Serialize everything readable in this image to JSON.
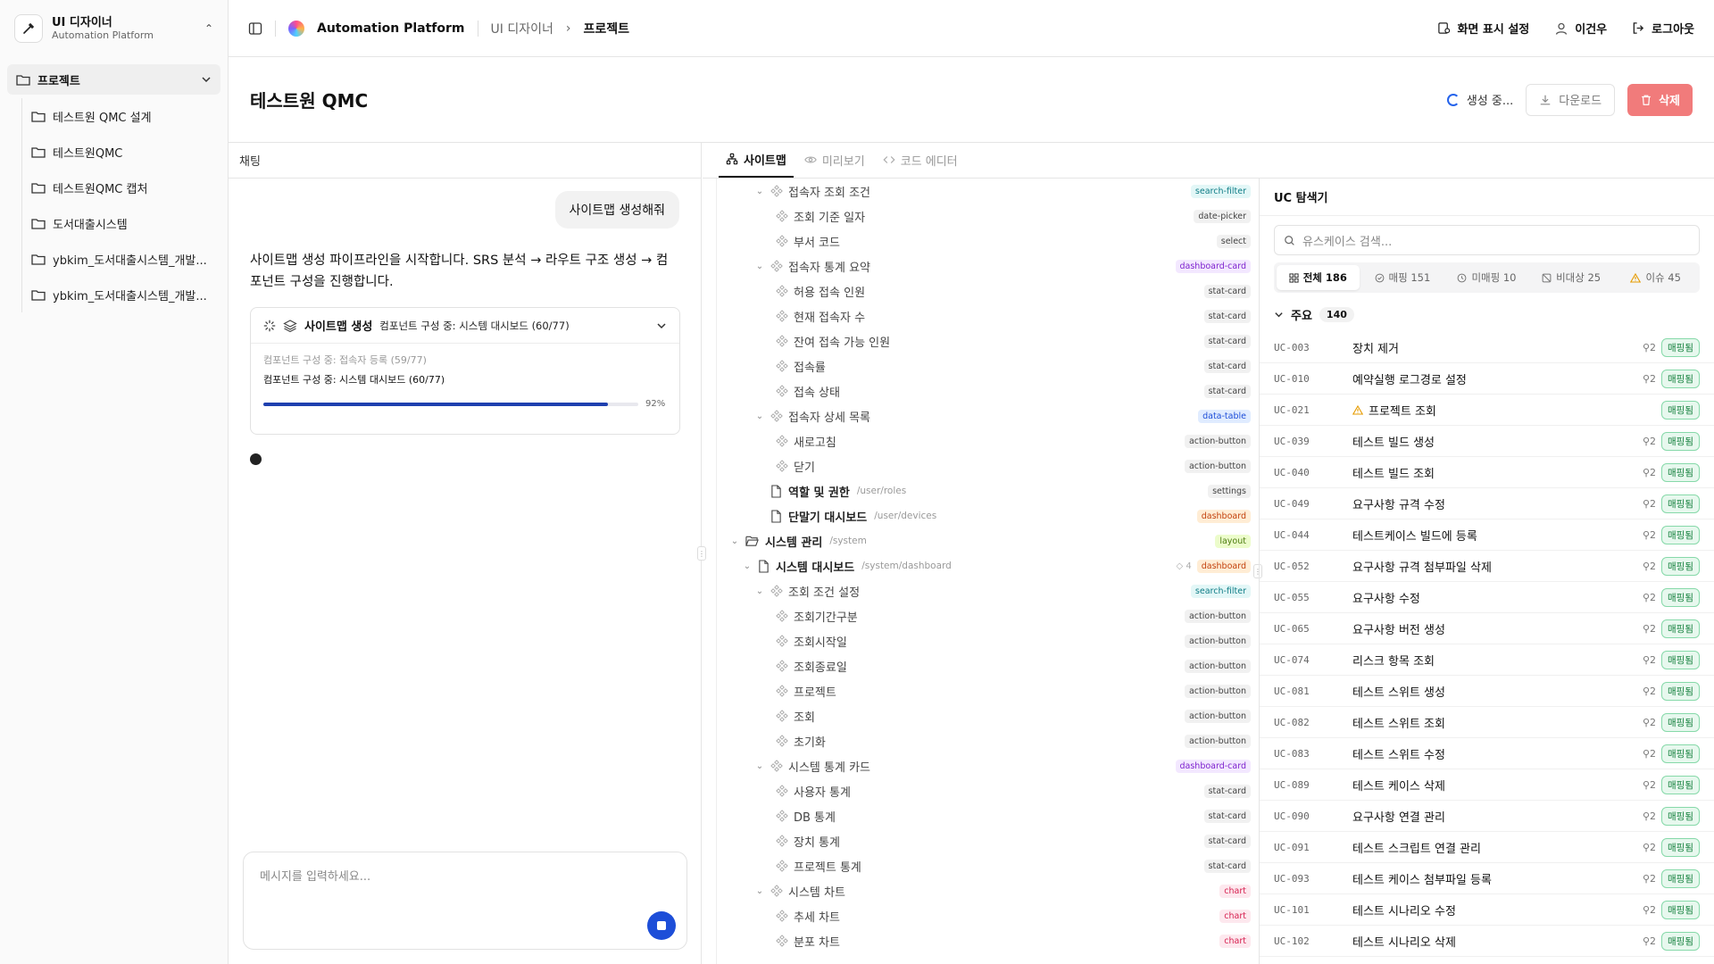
{
  "sidebar": {
    "brand_title": "UI 디자이너",
    "brand_subtitle": "Automation Platform",
    "group_label": "프로젝트",
    "items": [
      {
        "label": "테스트원 QMC 설계"
      },
      {
        "label": "테스트원QMC"
      },
      {
        "label": "테스트원QMC 캡처"
      },
      {
        "label": "도서대출시스템"
      },
      {
        "label": "ybkim_도서대출시스템_개발..."
      },
      {
        "label": "ybkim_도서대출시스템_개발..."
      }
    ]
  },
  "topbar": {
    "platform": "Automation Platform",
    "breadcrumb_parent": "UI 디자이너",
    "breadcrumb_current": "프로젝트",
    "display_settings": "화면 표시 설정",
    "user_name": "이건우",
    "logout": "로그아웃"
  },
  "header": {
    "title": "테스트원 QMC",
    "status": "생성 중...",
    "download": "다운로드",
    "delete": "삭제"
  },
  "chat": {
    "header": "채팅",
    "user_message": "사이트맵 생성해줘",
    "assistant_message": "사이트맵 생성 파이프라인을 시작합니다. SRS 분석 → 라우트 구조 생성 → 컴포넌트 구성을 진행합니다.",
    "pipeline": {
      "title": "사이트맵 생성",
      "subtitle": "컴포넌트 구성 중: 시스템 대시보드 (60/77)",
      "previous_step": "컴포넌트 구성 중: 접속자 등록 (59/77)",
      "current_step": "컴포넌트 구성 중: 시스템 대시보드 (60/77)",
      "progress": 0.92,
      "progress_label": "92%"
    },
    "input_placeholder": "메시지를 입력하세요..."
  },
  "tabs": [
    {
      "label": "사이트맵"
    },
    {
      "label": "미리보기"
    },
    {
      "label": "코드 에디터"
    }
  ],
  "tree": [
    {
      "label": "접속자 조회 조건",
      "kind": "component",
      "level": 3,
      "chevron": true,
      "tag": "search-filter",
      "tag_color": "teal"
    },
    {
      "label": "조회 기준 일자",
      "kind": "component",
      "level": 4,
      "tag": "date-picker",
      "tag_color": "gray"
    },
    {
      "label": "부서 코드",
      "kind": "component",
      "level": 4,
      "tag": "select",
      "tag_color": "gray"
    },
    {
      "label": "접속자 통계 요약",
      "kind": "component",
      "level": 3,
      "chevron": true,
      "tag": "dashboard-card",
      "tag_color": "purple"
    },
    {
      "label": "허용 접속 인원",
      "kind": "component",
      "level": 4,
      "tag": "stat-card",
      "tag_color": "gray"
    },
    {
      "label": "현재 접속자 수",
      "kind": "component",
      "level": 4,
      "tag": "stat-card",
      "tag_color": "gray"
    },
    {
      "label": "잔여 접속 가능 인원",
      "kind": "component",
      "level": 4,
      "tag": "stat-card",
      "tag_color": "gray"
    },
    {
      "label": "접속률",
      "kind": "component",
      "level": 4,
      "tag": "stat-card",
      "tag_color": "gray"
    },
    {
      "label": "접속 상태",
      "kind": "component",
      "level": 4,
      "tag": "stat-card",
      "tag_color": "gray"
    },
    {
      "label": "접속자 상세 목록",
      "kind": "component",
      "level": 3,
      "chevron": true,
      "tag": "data-table",
      "tag_color": "blue"
    },
    {
      "label": "새로고침",
      "kind": "component",
      "level": 4,
      "tag": "action-button",
      "tag_color": "gray"
    },
    {
      "label": "닫기",
      "kind": "component",
      "level": 4,
      "tag": "action-button",
      "tag_color": "gray"
    },
    {
      "label": "역할 및 권한",
      "kind": "page",
      "level": 2,
      "path": "/user/roles",
      "tag": "settings",
      "tag_color": "gray",
      "bold": true
    },
    {
      "label": "단말기 대시보드",
      "kind": "page",
      "level": 2,
      "path": "/user/devices",
      "tag": "dashboard",
      "tag_color": "orange",
      "bold": true
    },
    {
      "label": "시스템 관리",
      "kind": "folder",
      "level": 0,
      "chevron": true,
      "path": "/system",
      "tag": "layout",
      "tag_color": "lime",
      "bold": true
    },
    {
      "label": "시스템 대시보드",
      "kind": "page",
      "level": 1,
      "chevron": true,
      "path": "/system/dashboard",
      "count": "4",
      "tag": "dashboard",
      "tag_color": "orange",
      "bold": true
    },
    {
      "label": "조회 조건 설정",
      "kind": "component",
      "level": 3,
      "chevron": true,
      "tag": "search-filter",
      "tag_color": "teal"
    },
    {
      "label": "조회기간구분",
      "kind": "component",
      "level": 4,
      "tag": "action-button",
      "tag_color": "gray"
    },
    {
      "label": "조회시작일",
      "kind": "component",
      "level": 4,
      "tag": "action-button",
      "tag_color": "gray"
    },
    {
      "label": "조회종료일",
      "kind": "component",
      "level": 4,
      "tag": "action-button",
      "tag_color": "gray"
    },
    {
      "label": "프로젝트",
      "kind": "component",
      "level": 4,
      "tag": "action-button",
      "tag_color": "gray"
    },
    {
      "label": "조회",
      "kind": "component",
      "level": 4,
      "tag": "action-button",
      "tag_color": "gray"
    },
    {
      "label": "초기화",
      "kind": "component",
      "level": 4,
      "tag": "action-button",
      "tag_color": "gray"
    },
    {
      "label": "시스템 통계 카드",
      "kind": "component",
      "level": 3,
      "chevron": true,
      "tag": "dashboard-card",
      "tag_color": "purple"
    },
    {
      "label": "사용자 통계",
      "kind": "component",
      "level": 4,
      "tag": "stat-card",
      "tag_color": "gray"
    },
    {
      "label": "DB 통계",
      "kind": "component",
      "level": 4,
      "tag": "stat-card",
      "tag_color": "gray"
    },
    {
      "label": "장치 통계",
      "kind": "component",
      "level": 4,
      "tag": "stat-card",
      "tag_color": "gray"
    },
    {
      "label": "프로젝트 통계",
      "kind": "component",
      "level": 4,
      "tag": "stat-card",
      "tag_color": "gray"
    },
    {
      "label": "시스템 차트",
      "kind": "component",
      "level": 3,
      "chevron": true,
      "tag": "chart",
      "tag_color": "pink"
    },
    {
      "label": "추세 차트",
      "kind": "component",
      "level": 4,
      "tag": "chart",
      "tag_color": "pink"
    },
    {
      "label": "분포 차트",
      "kind": "component",
      "level": 4,
      "tag": "chart",
      "tag_color": "pink"
    }
  ],
  "uc_explorer": {
    "title": "UC 탐색기",
    "search_placeholder": "유스케이스 검색...",
    "filters": [
      {
        "label": "전체 186",
        "icon": "grid-icon"
      },
      {
        "label": "매핑 151",
        "icon": "check-circle-icon"
      },
      {
        "label": "미매핑 10",
        "icon": "clock-icon"
      },
      {
        "label": "비대상 25",
        "icon": "no-entry-icon"
      },
      {
        "label": "이슈 45",
        "icon": "warning-icon"
      }
    ],
    "group": {
      "label": "주요",
      "count": "140"
    },
    "badge_label": "매핑됨",
    "rows": [
      {
        "id": "UC-003",
        "name": "장치 제거",
        "links": "2"
      },
      {
        "id": "UC-010",
        "name": "예약실행 로그경로 설정",
        "links": "2"
      },
      {
        "id": "UC-021",
        "name": "프로젝트 조회",
        "links": "",
        "warning": true
      },
      {
        "id": "UC-039",
        "name": "테스트 빌드 생성",
        "links": "2"
      },
      {
        "id": "UC-040",
        "name": "테스트 빌드 조회",
        "links": "2"
      },
      {
        "id": "UC-049",
        "name": "요구사항 규격 수정",
        "links": "2"
      },
      {
        "id": "UC-044",
        "name": "테스트케이스 빌드에 등록",
        "links": "2"
      },
      {
        "id": "UC-052",
        "name": "요구사항 규격 첨부파일 삭제",
        "links": "2"
      },
      {
        "id": "UC-055",
        "name": "요구사항 수정",
        "links": "2"
      },
      {
        "id": "UC-065",
        "name": "요구사항 버전 생성",
        "links": "2"
      },
      {
        "id": "UC-074",
        "name": "리스크 항목 조회",
        "links": "2"
      },
      {
        "id": "UC-081",
        "name": "테스트 스위트 생성",
        "links": "2"
      },
      {
        "id": "UC-082",
        "name": "테스트 스위트 조회",
        "links": "2"
      },
      {
        "id": "UC-083",
        "name": "테스트 스위트 수정",
        "links": "2"
      },
      {
        "id": "UC-089",
        "name": "테스트 케이스 삭제",
        "links": "2"
      },
      {
        "id": "UC-090",
        "name": "요구사항 연결 관리",
        "links": "2"
      },
      {
        "id": "UC-091",
        "name": "테스트 스크립트 연결 관리",
        "links": "2"
      },
      {
        "id": "UC-093",
        "name": "테스트 케이스 첨부파일 등록",
        "links": "2"
      },
      {
        "id": "UC-101",
        "name": "테스트 시나리오 수정",
        "links": "2"
      },
      {
        "id": "UC-102",
        "name": "테스트 시나리오 삭제",
        "links": "2"
      }
    ]
  }
}
